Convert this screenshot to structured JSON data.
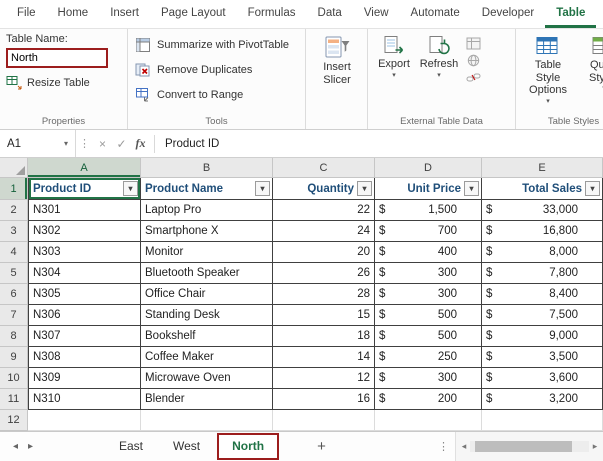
{
  "ribbon_tabs": {
    "items": [
      "File",
      "Home",
      "Insert",
      "Page Layout",
      "Formulas",
      "Data",
      "View",
      "Automate",
      "Developer",
      "Table"
    ],
    "active": "Table"
  },
  "ribbon": {
    "properties_group": {
      "table_name_label": "Table Name:",
      "table_name_value": "North",
      "resize_table_label": "Resize Table",
      "group_label": "Properties"
    },
    "tools_group": {
      "items": [
        "Summarize with PivotTable",
        "Remove Duplicates",
        "Convert to Range"
      ],
      "group_label": "Tools"
    },
    "insert_slicer_label": "Insert Slicer",
    "external_group": {
      "export_label": "Export",
      "refresh_label": "Refresh",
      "group_label": "External Table Data"
    },
    "styles_group": {
      "table_style_options_label": "Table Style Options",
      "quick_styles_label": "Quick Styles",
      "group_label": "Table Styles"
    }
  },
  "formula_bar": {
    "name_box": "A1",
    "formula_content": "Product ID"
  },
  "grid": {
    "column_letters": [
      "A",
      "B",
      "C",
      "D",
      "E"
    ],
    "row_numbers": [
      "1",
      "2",
      "3",
      "4",
      "5",
      "6",
      "7",
      "8",
      "9",
      "10",
      "11",
      "12"
    ],
    "table_headers": [
      "Product ID",
      "Product Name",
      "Quantity",
      "Unit Price",
      "Total Sales"
    ],
    "currency_symbol": "$",
    "rows": [
      {
        "product_id": "N301",
        "product_name": "Laptop Pro",
        "quantity": "22",
        "unit_price": "1,500",
        "total_sales": "33,000"
      },
      {
        "product_id": "N302",
        "product_name": "Smartphone X",
        "quantity": "24",
        "unit_price": "700",
        "total_sales": "16,800"
      },
      {
        "product_id": "N303",
        "product_name": "Monitor",
        "quantity": "20",
        "unit_price": "400",
        "total_sales": "8,000"
      },
      {
        "product_id": "N304",
        "product_name": "Bluetooth Speaker",
        "quantity": "26",
        "unit_price": "300",
        "total_sales": "7,800"
      },
      {
        "product_id": "N305",
        "product_name": "Office Chair",
        "quantity": "28",
        "unit_price": "300",
        "total_sales": "8,400"
      },
      {
        "product_id": "N306",
        "product_name": "Standing Desk",
        "quantity": "15",
        "unit_price": "500",
        "total_sales": "7,500"
      },
      {
        "product_id": "N307",
        "product_name": "Bookshelf",
        "quantity": "18",
        "unit_price": "500",
        "total_sales": "9,000"
      },
      {
        "product_id": "N308",
        "product_name": "Coffee Maker",
        "quantity": "14",
        "unit_price": "250",
        "total_sales": "3,500"
      },
      {
        "product_id": "N309",
        "product_name": "Microwave Oven",
        "quantity": "12",
        "unit_price": "300",
        "total_sales": "3,600"
      },
      {
        "product_id": "N310",
        "product_name": "Blender",
        "quantity": "16",
        "unit_price": "200",
        "total_sales": "3,200"
      }
    ]
  },
  "sheet_bar": {
    "tabs": [
      "East",
      "West",
      "North"
    ],
    "active_tab": "North",
    "add_sheet_label": "+"
  }
}
